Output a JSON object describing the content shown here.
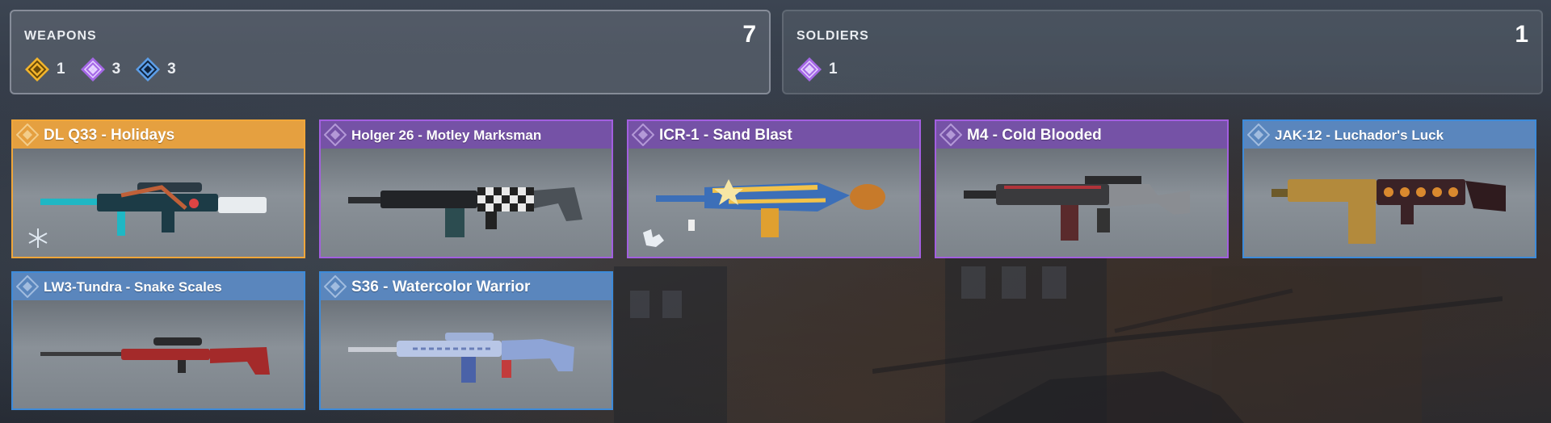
{
  "colors": {
    "legendary": "#f0a63a",
    "epic": "#a35fe0",
    "rare": "#3d8bda"
  },
  "weapons_panel": {
    "title": "WEAPONS",
    "total": "7",
    "counts": [
      {
        "rarity": "legendary",
        "icon": "legendary-diamond-icon",
        "value": "1"
      },
      {
        "rarity": "epic",
        "icon": "epic-diamond-icon",
        "value": "3"
      },
      {
        "rarity": "rare",
        "icon": "rare-diamond-icon",
        "value": "3"
      }
    ]
  },
  "soldiers_panel": {
    "title": "SOLDIERS",
    "total": "1",
    "counts": [
      {
        "rarity": "epic",
        "icon": "epic-diamond-icon",
        "value": "1"
      }
    ]
  },
  "items": [
    {
      "name": "DL Q33 - Holidays",
      "rarity": "legendary",
      "icon": "snowflake-badge-icon"
    },
    {
      "name": "Holger 26 - Motley Marksman",
      "rarity": "epic"
    },
    {
      "name": "ICR-1 - Sand Blast",
      "rarity": "epic",
      "icon": "gamepad-badge-icon"
    },
    {
      "name": "M4 - Cold Blooded",
      "rarity": "epic"
    },
    {
      "name": "JAK-12 - Luchador's Luck",
      "rarity": "rare"
    },
    {
      "name": "LW3-Tundra - Snake Scales",
      "rarity": "rare"
    },
    {
      "name": "S36 - Watercolor Warrior",
      "rarity": "rare"
    }
  ]
}
